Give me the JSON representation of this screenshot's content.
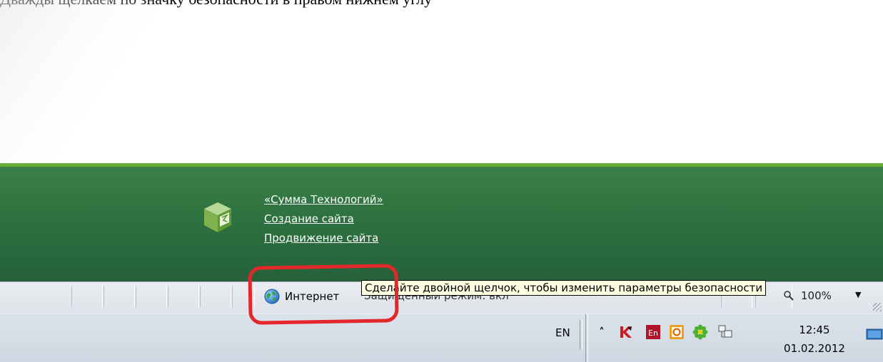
{
  "caption": "Дважды щелкаем по значку безопасности в правом нижнем углу",
  "footer": {
    "links": [
      "«Сумма Технологий»",
      "Создание сайта",
      "Продвижение сайта"
    ]
  },
  "statusbar": {
    "zone_label": "Интернет",
    "protected_mode": "Защищенный режим: вкл",
    "zoom": "100%",
    "zoom_arrow": "▼"
  },
  "tooltip": "Сделайте двойной щелчок, чтобы изменить параметры безопасности",
  "taskbar": {
    "language": "EN",
    "expand_arrow": "˄",
    "tray_icons": [
      "kaspersky-icon",
      "lingvo-icon",
      "outlook-icon",
      "icq-icon",
      "network-icon"
    ],
    "clock_time": "12:45",
    "clock_date": "01.02.2012"
  },
  "colors": {
    "footer_green": "#2f7340",
    "footer_top_line": "#67ad38",
    "highlight_red": "#e2282b",
    "tooltip_bg": "#ffffe1"
  }
}
